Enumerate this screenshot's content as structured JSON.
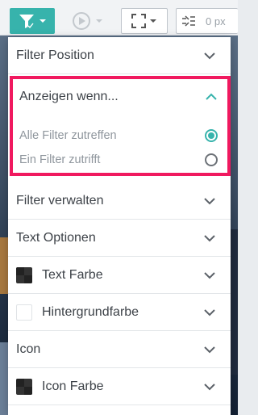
{
  "toolbar": {
    "filter_icon": "filter-check-icon",
    "animation_icon": "play-circle-icon",
    "frame_icon": "fullscreen-frame-icon",
    "spacing_icon": "spacing-icon",
    "spacing_value": "0 px",
    "accent_color": "#37b3ac"
  },
  "menu": {
    "filter_position": "Filter Position",
    "show_when": {
      "label": "Anzeigen wenn...",
      "options": [
        {
          "label": "Alle Filter zutreffen",
          "selected": true
        },
        {
          "label": "Ein Filter zutrifft",
          "selected": false
        }
      ],
      "highlight_color": "#f0195f"
    },
    "manage_filters": "Filter verwalten",
    "text_options": "Text Optionen",
    "text_color": "Text Farbe",
    "background_color": "Hintergrundfarbe",
    "icon": "Icon",
    "icon_color": "Icon Farbe"
  }
}
